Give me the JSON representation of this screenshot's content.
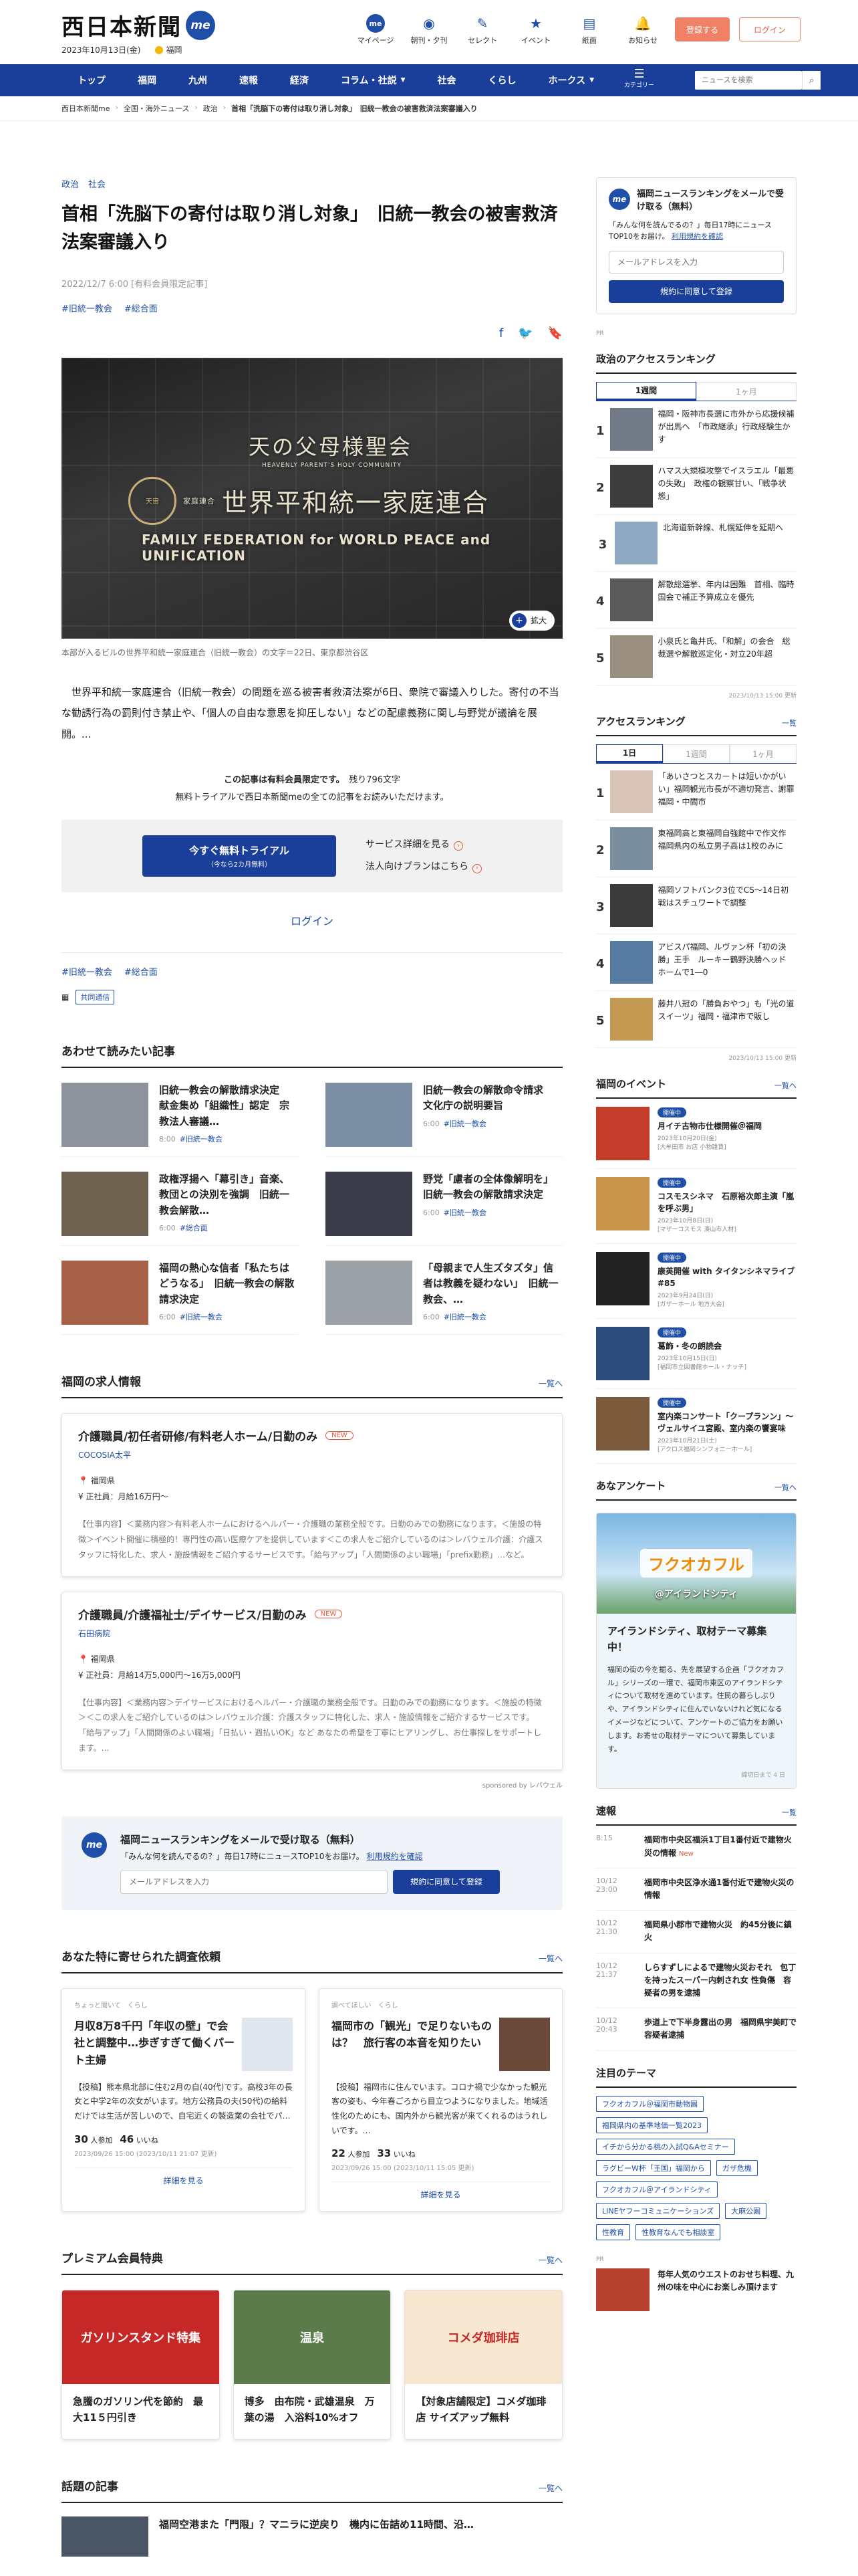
{
  "header": {
    "logo": "西日本新聞",
    "me": "me",
    "date": "2023年10月13日(金)",
    "weather_city": "福岡",
    "icons": [
      {
        "label": "マイページ",
        "icon": "me-icon"
      },
      {
        "label": "朝刊・夕刊",
        "icon": "newspaper-icon"
      },
      {
        "label": "セレクト",
        "icon": "select-icon"
      },
      {
        "label": "イベント",
        "icon": "event-icon"
      },
      {
        "label": "紙面",
        "icon": "paper-icon"
      },
      {
        "label": "お知らせ",
        "icon": "notice-icon"
      }
    ],
    "register": "登録する",
    "login": "ログイン"
  },
  "nav": {
    "items": [
      "トップ",
      "福岡",
      "九州",
      "速報",
      "経済",
      "コラム・社説",
      "社会",
      "くらし",
      "ホークス"
    ],
    "category_label": "カテゴリー",
    "search_placeholder": "ニュースを検索"
  },
  "breadcrumb": [
    "西日本新聞me",
    "全国・海外ニュース",
    "政治",
    "首相「洗脳下の寄付は取り消し対象」　旧統一教会の被害救済法案審議入り"
  ],
  "article": {
    "categories": [
      "政治",
      "社会"
    ],
    "headline": "首相「洗脳下の寄付は取り消し対象」　旧統一教会の被害救済法案審議入り",
    "date": "2022/12/7 6:00 [有料会員限定記事]",
    "tags": [
      "#旧統一教会",
      "#総合面"
    ],
    "sign": {
      "line1": "天の父母様聖会",
      "line1_sub": "HEAVENLY PARENT'S HOLY COMMUNITY",
      "seal": "天宙",
      "line2": "世界平和統一家庭連合",
      "line2_sub": "家庭連合",
      "line3": "FAMILY FEDERATION for WORLD PEACE and UNIFICATION"
    },
    "zoom": "拡大",
    "caption": "本部が入るビルの世界平和統一家庭連合（旧統一教会）の文字＝22日、東京都渋谷区",
    "body": "世界平和統一家庭連合（旧統一教会）の問題を巡る被害者救済法案が6日、衆院で審議入りした。寄付の不当な勧誘行為の罰則付き禁止や、「個人の自由な意思を抑圧しない」などの配慮義務に関し与野党が議論を展開。...",
    "paywall_1": "この記事は有料会員限定です。",
    "paywall_remaining": "残り796文字",
    "paywall_2": "無料トライアルで西日本新聞meの全ての記事をお読みいただけます。",
    "trial_btn": "今すぐ無料トライアル",
    "trial_sub": "（今なら2カ月無料）",
    "service_link": "サービス詳細を見る",
    "corp_link": "法人向けプランはこちら",
    "login_link": "ログイン",
    "source_badge": "共同通信"
  },
  "related": {
    "title": "あわせて読みたい記事",
    "items": [
      {
        "title": "旧統一教会の解散請求決定　献金集め「組織性」認定　宗教法人審議…",
        "date": "8:00",
        "tag": "#旧統一教会",
        "color": "#8d939c"
      },
      {
        "title": "旧統一教会の解散命令請求　文化庁の説明要旨",
        "date": "6:00",
        "tag": "#旧統一教会",
        "color": "#7b8ea3"
      },
      {
        "title": "政権浮揚へ「幕引き」音楽、教団との決別を強調　旧統一教会解散…",
        "date": "6:00",
        "tag": "#総合面",
        "color": "#6f6150"
      },
      {
        "title": "野党「慮者の全体像解明を」　旧統一教会の解散請求決定",
        "date": "6:00",
        "tag": "#旧統一教会",
        "color": "#3b3c4a"
      },
      {
        "title": "福岡の熱心な信者「私たちはどうなる」　旧統一教会の解散請求決定",
        "date": "6:00",
        "tag": "#旧統一教会",
        "color": "#a86048"
      },
      {
        "title": "「母親まで人生ズタズタ」信者は教義を疑わない」　旧統一教会、…",
        "date": "6:00",
        "tag": "#旧統一教会",
        "color": "#9aa0a6"
      }
    ]
  },
  "jobs": {
    "title": "福岡の求人情報",
    "more": "一覧へ",
    "items": [
      {
        "title": "介護職員/初任者研修/有料老人ホーム/日勤のみ",
        "new": "NEW",
        "company": "COCOSIA太平",
        "place": "福岡県",
        "pay": "正社員：月給16万円〜",
        "desc": "【仕事内容】＜業務内容＞有料老人ホームにおけるヘルパー・介護職の業務全般です。日勤のみでの勤務になります。＜施設の特徴＞イベント開催に積極的！専門性の高い医療ケアを提供しています＜この求人をご紹介しているのは＞レバウェル介護：介護スタッフに特化した、求人・施設情報をご紹介するサービスです。「給与アップ」「人間関係のよい職場」「prefix勤務」…など。"
      },
      {
        "title": "介護職員/介護福祉士/デイサービス/日勤のみ",
        "new": "NEW",
        "company": "石田病院",
        "place": "福岡県",
        "pay": "正社員：月給14万5,000円〜16万5,000円",
        "desc": "【仕事内容】＜業務内容＞デイサービスにおけるヘルパー・介護職の業務全般です。日勤のみでの勤務になります。＜施設の特徴＞＜この求人をご紹介しているのは＞レバウェル介護：介護スタッフに特化した、求人・施設情報をご紹介するサービスです。「給与アップ」「人間関係のよい職場」「日払い・週払いOK」など あなたの希望を丁寧にヒアリングし、お仕事探しをサポートします。..."
      }
    ],
    "sponsor": "sponsored by レバウェル"
  },
  "mail": {
    "title": "福岡ニュースランキングをメールで受け取る（無料）",
    "desc": "「みんな何を読んでるの？」毎日17時にニュースTOP10をお届け。",
    "link": "利用規約を確認",
    "placeholder": "メールアドレスを入力",
    "btn": "規約に同意して登録"
  },
  "survey": {
    "title": "あなた特に寄せられた調査依頼",
    "more": "一覧へ",
    "items": [
      {
        "label": "ちょっと聞いて",
        "label2": "くらし",
        "title": "月収8万8千円「年収の壁」で会社と調整中…歩ぎすぎて働くパート主婦",
        "desc": "【投稿】熊本県北部に住む2月の自(40代)です。高校3年の長女と中学2年の次女がいます。地方公務員の夫(50代)の給料だけでは生活が苦しいので、自宅近くの製造業の会社でパ…",
        "count1": "30",
        "count2": "46",
        "date": "2023/09/26 15:00 (2023/10/11 21:07 更新)",
        "btn": "詳細を見る"
      },
      {
        "label": "調べてほしい",
        "label2": "くらし",
        "title": "福岡市の「観光」で足りないものは？　旅行客の本音を知りたい",
        "desc": "【投稿】福岡市に住んでいます。コロナ禍で少なかった観光客の姿も、今年春ごろから目立つようになりました。地域活性化のためにも、国内外から観光客が来てくれるのはうれしいです。…",
        "count1": "22",
        "count2": "33",
        "date": "2023/09/26 15:00 (2023/10/11 15:05 更新)",
        "btn": "詳細を見る"
      }
    ]
  },
  "premium": {
    "title": "プレミアム会員特典",
    "more": "一覧へ",
    "items": [
      {
        "img": "ガソリンスタンド特集",
        "title": "急騰のガソリン代を節約　最大11５円引き",
        "bg": "#c62828"
      },
      {
        "img": "温泉",
        "title": "博多　由布院・武雄温泉　万葉の湯　入浴料10%オフ",
        "bg": "#5b7b4a"
      },
      {
        "img": "コメダ珈琲店",
        "title": "【対象店舗限定】コメダ珈琲店 サイズアップ無料",
        "bg": "#f7e7d0"
      }
    ]
  },
  "topics": {
    "title": "話題の記事",
    "more": "一覧へ",
    "first": "福岡空港また「門限」？マニラに逆戻り　機内に缶詰め11時間、沿…"
  },
  "side": {
    "mail_title": "福岡ニュースランキングをメールで受け取る（無料）",
    "mail_desc": "「みんな何を読んでるの？」毎日17時にニュースTOP10をお届け。",
    "mail_link": "利用規約を確認",
    "mail_placeholder": "メールアドレスを入力",
    "mail_btn": "規約に同意して登録",
    "pr": "PR",
    "pol_title": "政治のアクセスランキング",
    "pol_tabs": [
      "1週間",
      "1ヶ月"
    ],
    "pol_items": [
      {
        "n": "1",
        "t": "福岡・阪神市長選に市外から応援候補が出馬へ　「市政継承」行政経験生かす",
        "c": "#6f7a86"
      },
      {
        "n": "2",
        "t": "ハマス大規模攻撃でイスラエル「最悪の失敗」　政権の観察甘い、「戦争状態」",
        "c": "#3d3d3d"
      },
      {
        "n": "3",
        "t": "北海道新幹線、札幌延伸を延期へ",
        "c": "#8fa8c2"
      },
      {
        "n": "4",
        "t": "解散総選挙、年内は困難　首相、臨時国会で補正予算成立を優先",
        "c": "#5a5a5a"
      },
      {
        "n": "5",
        "t": "小泉氏と亀井氏、「和解」の会合　総裁選や解散巡定化・対立20年超",
        "c": "#9a8f80"
      }
    ],
    "pol_date": "2023/10/13 15:00 更新",
    "acc_title": "アクセスランキング",
    "acc_more": "一覧",
    "acc_tabs": [
      "1日",
      "1週間",
      "1ヶ月"
    ],
    "acc_items": [
      {
        "n": "1",
        "t": "「あいさつとスカートは短いかがいい」福岡観光市長が不適切発言、謝罪　福岡・中間市",
        "c": "#d8c5b8"
      },
      {
        "n": "2",
        "t": "東福岡高と東福岡自強館中で作文作　福岡県内の私立男子高は1校のみに",
        "c": "#7a8e9e"
      },
      {
        "n": "3",
        "t": "福岡ソフトバンク3位でCS〜14日初戦はスチュワートで調整",
        "c": "#3a3a3a"
      },
      {
        "n": "4",
        "t": "アビスパ福岡、ルヴァン杯「初の決勝」王手　ルーキー鶴野決勝ヘッド　ホームで1―0",
        "c": "#567ba0"
      },
      {
        "n": "5",
        "t": "藤井八冠の「勝負おやつ」も「光の道スイーツ」福岡・福津市で販し",
        "c": "#c49a52"
      }
    ],
    "acc_date": "2023/10/13 15:00 更新",
    "events_title": "福岡のイベント",
    "events_more": "一覧へ",
    "events": [
      {
        "badge": "開催中",
        "t": "月イチ古物市仕様開催＠福岡",
        "d": "2023年10月20日(金)\n[大牟田市 お店 小物雑貨]",
        "c": "#c43d2a"
      },
      {
        "badge": "開催中",
        "t": "コスモスシネマ　石原裕次郎主演「嵐を呼ぶ男」",
        "d": "2023年10月8日(日)\n[マザーコスモス 湊山市人材]",
        "c": "#c9954a"
      },
      {
        "badge": "開催中",
        "t": "康英開催 with タイタンシネマライブ#85",
        "d": "2023年9月24日(日)\n[ガザーホール 地方大会]",
        "c": "#222"
      },
      {
        "badge": "開催中",
        "t": "葛飾・冬の朗読会",
        "d": "2023年10月15日(日)\n[福岡市立図書館ホール・ナッチ]",
        "c": "#2c4b7a"
      },
      {
        "badge": "開催中",
        "t": "室内楽コンサート「クープランン」〜ヴェルサイユ宮殿、室内楽の饗宴味",
        "d": "2023年10月21日(土)\n[アクロス福岡シンフォニーホール]",
        "c": "#7a5a3a"
      }
    ],
    "enq_title": "あなアンケート",
    "enq_more": "一覧へ",
    "enq_img": "フクオカフル",
    "enq_img_sub": "@アイランドシティ",
    "enq_t": "アイランドシティ、取材テーマ募集中！",
    "enq_d": "福岡の街の今を掘る、先を展望する企画「フクオカフル」シリーズの一環で、福岡市東区のアイランドシティについて取材を進めています。住民の暮らしぶりや、アイランドシティに住んでいないけれど気になるイメージなどについて、アンケートのご協力をお願いします。お寄せの取材テーマについて募集しています。",
    "enq_date": "締切日まで 4 日",
    "flash_title": "速報",
    "flash_more": "一覧",
    "flash": [
      {
        "time": "8:15",
        "t": "福岡市中央区福浜1丁目1番付近で建物火災の情報",
        "nw": "New"
      },
      {
        "time": "10/12 23:00",
        "t": "福岡市中央区浄水通1番付近で建物火災の情報",
        "nw": ""
      },
      {
        "time": "10/12 21:30",
        "t": "福岡県小郡市で建物火災　約45分後に鎮火",
        "nw": ""
      },
      {
        "time": "10/12 21:37",
        "t": "しらすずしによるで建物火災おそれ　包丁を持ったスーパー内刺され女 性負傷　容疑者の男を逮捕",
        "nw": ""
      },
      {
        "time": "10/12 20:43",
        "t": "歩道上で下半身露出の男　福岡県宇美町で容疑者逮捕",
        "nw": ""
      }
    ],
    "theme_title": "注目のテーマ",
    "themes": [
      "フクオカフル＠福岡市動物園",
      "福岡県内の基準地価一覧2023",
      "イチから分かる桃の入試Q&Aセミナー",
      "ラグビーW杯「王国」福岡から",
      "ガザ危機",
      "フクオカフル＠アイランドシティ",
      "LINEヤフーコミュニケーションズ",
      "大麻公園",
      "性教育",
      "性教育なんでも相談室"
    ],
    "pr2": "PR",
    "pr_item": "毎年人気のウエストのおせち料理、九州の味を中心にお楽しみ頂けます"
  }
}
